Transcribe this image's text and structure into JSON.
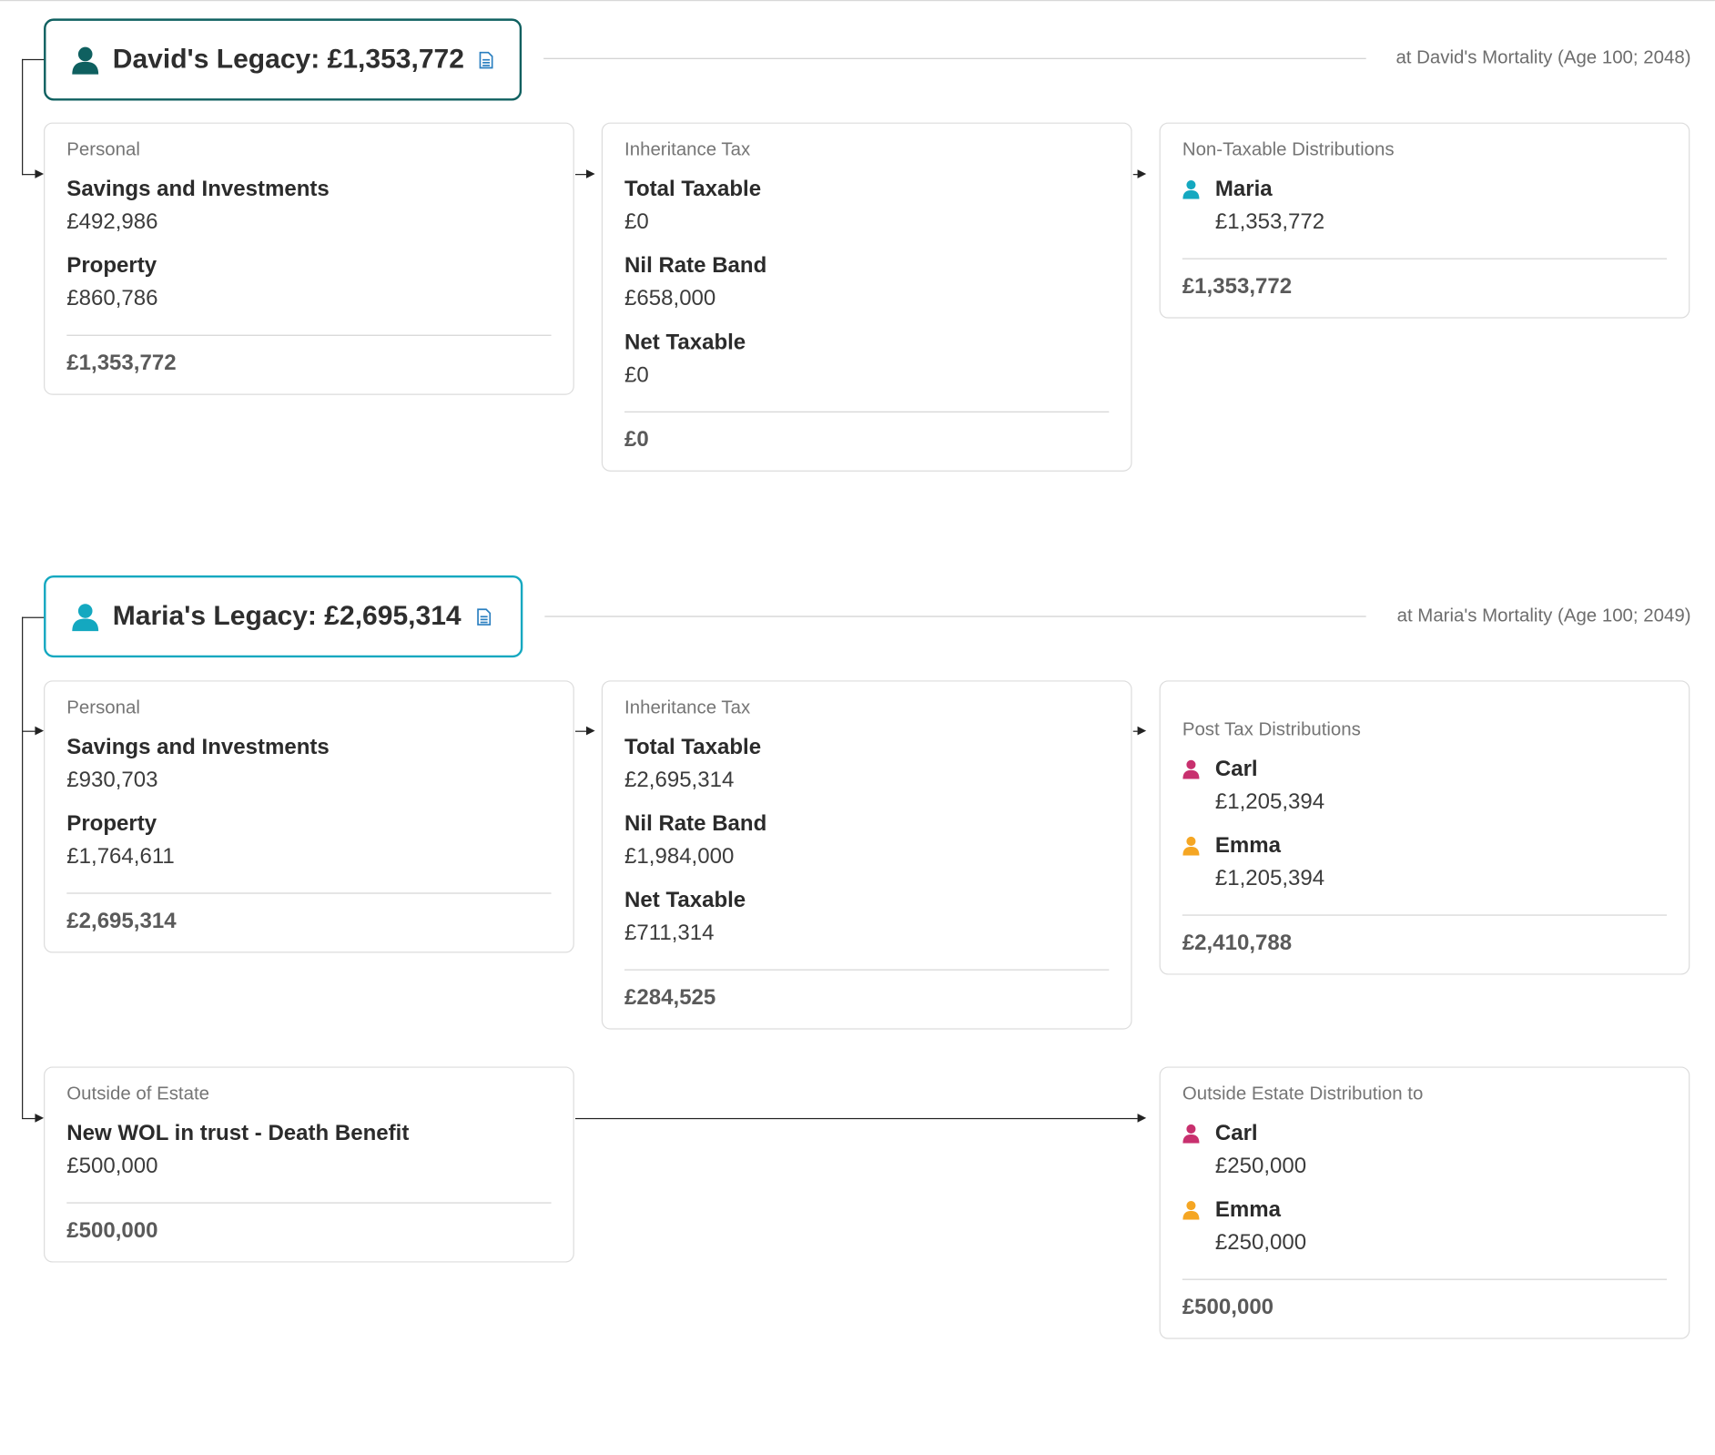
{
  "colors": {
    "david": "#0f6060",
    "maria": "#14a8c0",
    "carl": "#c8306e",
    "emma": "#f5a623"
  },
  "david": {
    "legacy_title": "David's Legacy: £1,353,772",
    "mortality": "at David's Mortality (Age 100; 2048)",
    "personal": {
      "category": "Personal",
      "items": [
        {
          "label": "Savings and Investments",
          "value": "£492,986"
        },
        {
          "label": "Property",
          "value": "£860,786"
        }
      ],
      "total": "£1,353,772"
    },
    "tax": {
      "category": "Inheritance Tax",
      "items": [
        {
          "label": "Total Taxable",
          "value": "£0"
        },
        {
          "label": "Nil Rate Band",
          "value": "£658,000"
        },
        {
          "label": "Net Taxable",
          "value": "£0"
        }
      ],
      "total": "£0"
    },
    "distribution": {
      "category": "Non-Taxable Distributions",
      "items": [
        {
          "name": "Maria",
          "value": "£1,353,772",
          "icon": "person-icon"
        }
      ],
      "total": "£1,353,772"
    }
  },
  "maria": {
    "legacy_title": "Maria's Legacy: £2,695,314",
    "mortality": "at Maria's Mortality (Age 100; 2049)",
    "personal": {
      "category": "Personal",
      "items": [
        {
          "label": "Savings and Investments",
          "value": "£930,703"
        },
        {
          "label": "Property",
          "value": "£1,764,611"
        }
      ],
      "total": "£2,695,314"
    },
    "tax": {
      "category": "Inheritance Tax",
      "items": [
        {
          "label": "Total Taxable",
          "value": "£2,695,314"
        },
        {
          "label": "Nil Rate Band",
          "value": "£1,984,000"
        },
        {
          "label": "Net Taxable",
          "value": "£711,314"
        }
      ],
      "total": "£284,525"
    },
    "distribution": {
      "category": "Post Tax Distributions",
      "items": [
        {
          "name": "Carl",
          "value": "£1,205,394",
          "icon": "person-icon"
        },
        {
          "name": "Emma",
          "value": "£1,205,394",
          "icon": "person-icon"
        }
      ],
      "total": "£2,410,788"
    },
    "outside": {
      "category": "Outside of Estate",
      "items": [
        {
          "label": "New WOL in trust - Death Benefit",
          "value": "£500,000"
        }
      ],
      "total": "£500,000"
    },
    "outside_distribution": {
      "category": "Outside Estate Distribution to",
      "items": [
        {
          "name": "Carl",
          "value": "£250,000",
          "icon": "person-icon"
        },
        {
          "name": "Emma",
          "value": "£250,000",
          "icon": "person-icon"
        }
      ],
      "total": "£500,000"
    }
  }
}
